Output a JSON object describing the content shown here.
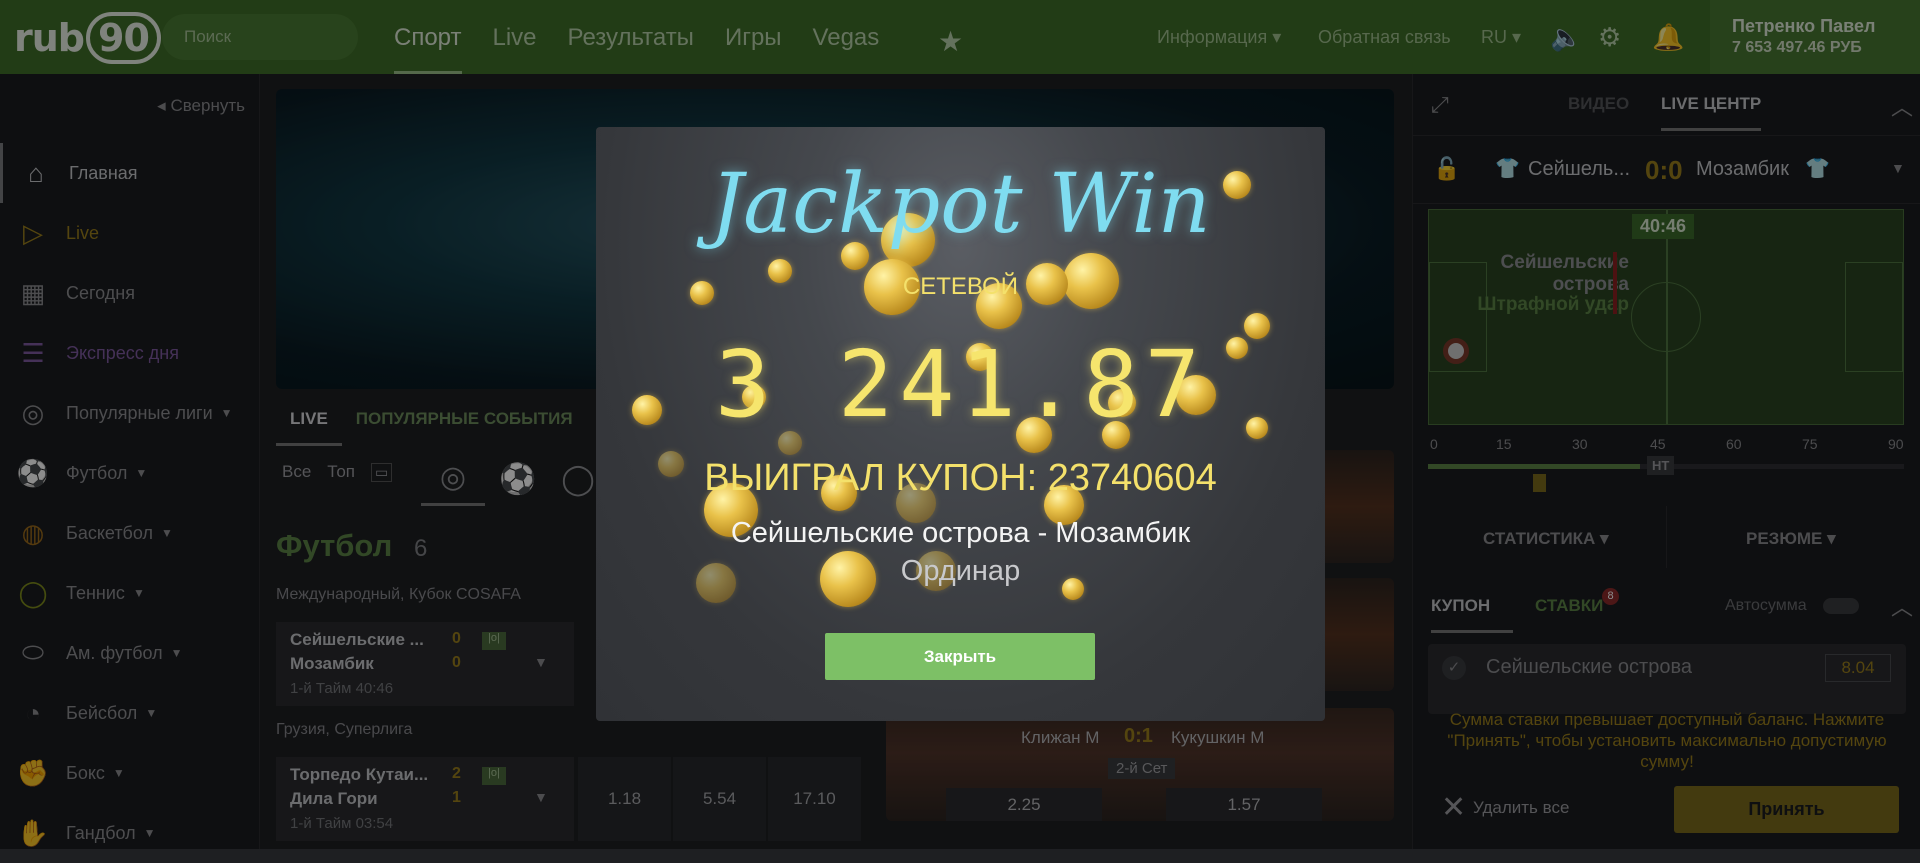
{
  "header": {
    "logo": "rub90",
    "search_placeholder": "Поиск",
    "nav": [
      "Спорт",
      "Live",
      "Результаты",
      "Игры",
      "Vegas"
    ],
    "info": "Информация",
    "feedback": "Обратная связь",
    "lang": "RU",
    "user_name": "Петренко Павел",
    "user_balance": "7 653 497.46 РУБ"
  },
  "sidebar": {
    "collapse": "Свернуть",
    "items": [
      {
        "label": "Главная",
        "icon": "home-icon"
      },
      {
        "label": "Live",
        "icon": "play-icon"
      },
      {
        "label": "Сегодня",
        "icon": "calendar-icon"
      },
      {
        "label": "Экспресс дня",
        "icon": "list-icon"
      },
      {
        "label": "Популярные лиги",
        "icon": "balls-icon"
      },
      {
        "label": "Футбол",
        "icon": "soccer-icon"
      },
      {
        "label": "Баскетбол",
        "icon": "basketball-icon"
      },
      {
        "label": "Теннис",
        "icon": "tennis-icon"
      },
      {
        "label": "Ам. футбол",
        "icon": "american-football-icon"
      },
      {
        "label": "Бейсбол",
        "icon": "baseball-icon"
      },
      {
        "label": "Бокс",
        "icon": "boxing-icon"
      },
      {
        "label": "Гандбол",
        "icon": "handball-icon"
      }
    ]
  },
  "center": {
    "tabs": [
      "LIVE",
      "ПОПУЛЯРНЫЕ СОБЫТИЯ"
    ],
    "filters": [
      "Все",
      "Топ"
    ],
    "section_title": "Футбол",
    "section_count": "6",
    "league1": "Международный, Кубок COSAFA",
    "match1": {
      "team1": "Сейшельские ...",
      "team2": "Мозамбик",
      "score1": "0",
      "score2": "0",
      "time": "1-й Тайм 40:46"
    },
    "league2": "Грузия, Суперлига",
    "match2": {
      "team1": "Торпедо Кутаи...",
      "team2": "Дила Гори",
      "score1": "2",
      "score2": "1",
      "time": "1-й Тайм 03:54",
      "odds": [
        "1.18",
        "5.54",
        "17.10"
      ]
    },
    "tennis": {
      "player1": "Клижан М",
      "score": "0:1",
      "player2": "Кукушкин М",
      "set": "2-й Сет",
      "odd1": "2.25",
      "odd2": "1.57"
    }
  },
  "right": {
    "tab_video": "ВИДЕО",
    "tab_live": "LIVE ЦЕНТР",
    "team1": "Сейшель...",
    "score": "0:0",
    "team2": "Мозамбик",
    "clock": "40:46",
    "event_team": "Сейшельские острова",
    "event": "Штрафной удар",
    "timeline_marks": [
      "0",
      "15",
      "30",
      "45",
      "60",
      "75",
      "90"
    ],
    "ht": "HT",
    "stats": "СТАТИСТИКА",
    "summary": "РЕЗЮМЕ",
    "coupon": "КУПОН",
    "bets": "СТАВКИ",
    "bets_count": "8",
    "autosum": "Автосумма",
    "bet_team": "Сейшельские острова",
    "bet_odd": "8.04",
    "warning": "Сумма ставки превышает доступный баланс. Нажмите \"Принять\", чтобы установить максимально допустимую сумму!",
    "delete_all": "Удалить все",
    "accept": "Принять"
  },
  "modal": {
    "title": "Jackpot Win",
    "subtitle": "СЕТЕВОЙ",
    "amount": "3 241.87",
    "coupon": "ВЫИГРАЛ КУПОН: 23740604",
    "match": "Сейшельские острова - Мозамбик",
    "type": "Ординар",
    "close": "Закрыть"
  }
}
